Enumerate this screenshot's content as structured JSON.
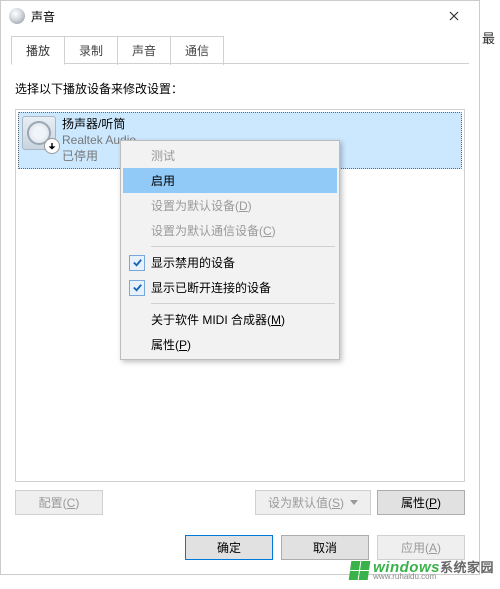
{
  "window": {
    "title": "声音"
  },
  "tabs": [
    {
      "label": "播放",
      "active": true
    },
    {
      "label": "录制",
      "active": false
    },
    {
      "label": "声音",
      "active": false
    },
    {
      "label": "通信",
      "active": false
    }
  ],
  "instruction": "选择以下播放设备来修改设置：",
  "device": {
    "name": "扬声器/听筒",
    "sub": "Realtek Audio",
    "status": "已停用",
    "overlay_icon": "arrow-down-badge"
  },
  "context_menu": {
    "items": [
      {
        "label": "测试",
        "disabled": true
      },
      {
        "label": "启用",
        "highlighted": true
      },
      {
        "label_prefix": "设置为默认设备(",
        "accel": "D",
        "label_suffix": ")",
        "disabled": true
      },
      {
        "label_prefix": "设置为默认通信设备(",
        "accel": "C",
        "label_suffix": ")",
        "disabled": true
      },
      {
        "sep": true
      },
      {
        "label": "显示禁用的设备",
        "checked": true
      },
      {
        "label": "显示已断开连接的设备",
        "checked": true
      },
      {
        "sep": true
      },
      {
        "label_prefix": "关于软件 MIDI 合成器(",
        "accel": "M",
        "label_suffix": ")"
      },
      {
        "label_prefix": "属性(",
        "accel": "P",
        "label_suffix": ")"
      }
    ]
  },
  "bottom_buttons": {
    "configure_prefix": "配置(",
    "configure_accel": "C",
    "configure_suffix": ")",
    "set_default_prefix": "设为默认值(",
    "set_default_accel": "S",
    "set_default_suffix": ")",
    "properties_prefix": "属性(",
    "properties_accel": "P",
    "properties_suffix": ")"
  },
  "dialog_buttons": {
    "ok": "确定",
    "cancel": "取消",
    "apply_prefix": "应用(",
    "apply_accel": "A",
    "apply_suffix": ")"
  },
  "watermark": {
    "brand": "windows",
    "tagline": "系统家园",
    "url": "www.ruhaidu.com"
  },
  "stray_char": "最"
}
